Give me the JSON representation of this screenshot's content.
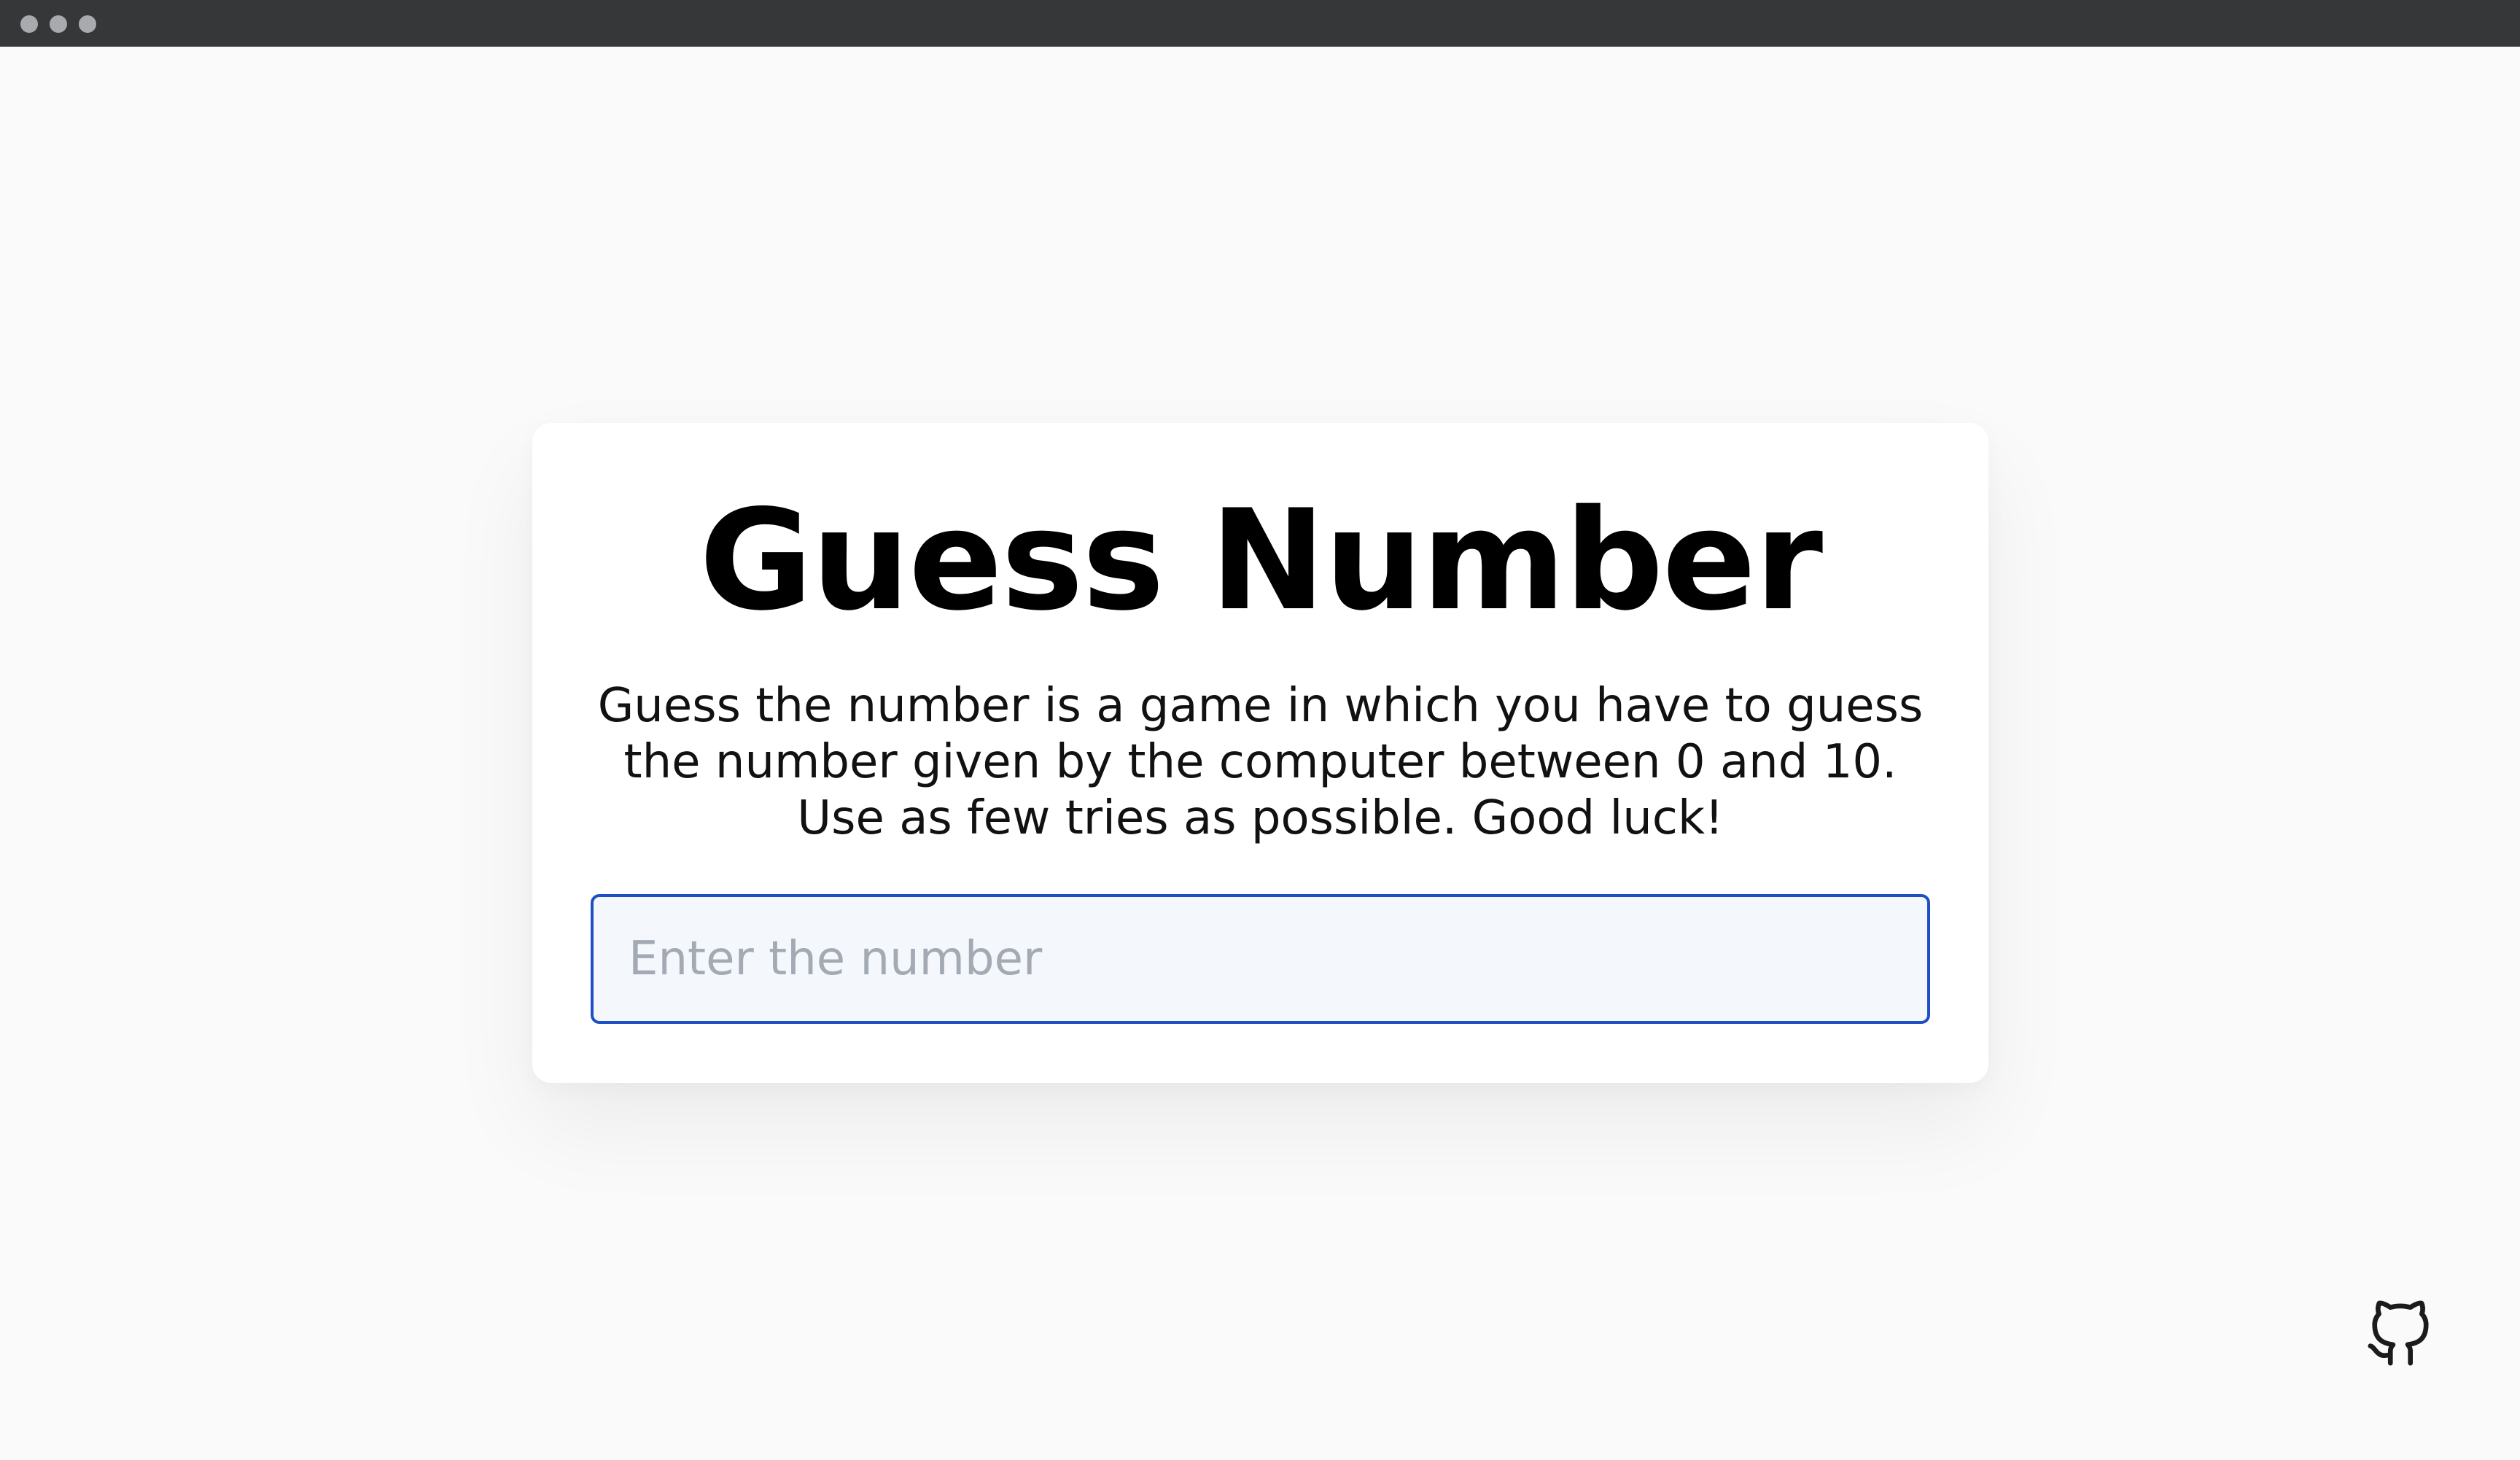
{
  "window": {
    "controls": [
      "close",
      "minimize",
      "maximize"
    ],
    "titlebar_color": "#363739"
  },
  "game": {
    "title": "Guess Number",
    "description": "Guess the number is a game in which you have to guess the number given by the computer between 0 and 10. Use as few tries as possible. Good luck!",
    "input": {
      "value": "",
      "placeholder": "Enter the number"
    }
  },
  "footer": {
    "github_icon": "github-icon"
  },
  "colors": {
    "background": "#fafafa",
    "card": "#ffffff",
    "input_border": "#1f4fc4",
    "input_bg": "#f4f8fc"
  }
}
